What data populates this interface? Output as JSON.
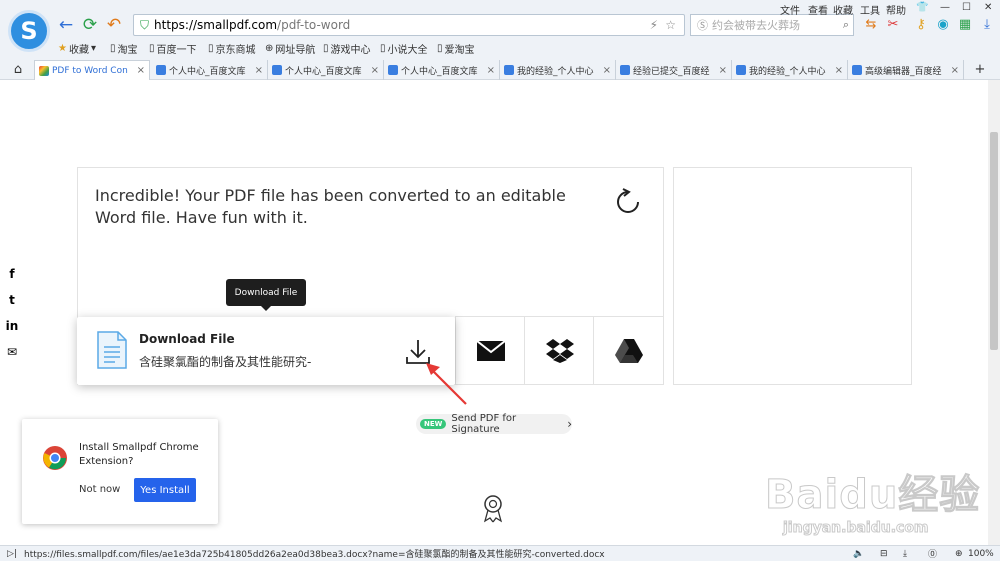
{
  "browser": {
    "url_domain": "https://smallpdf.com",
    "url_path": "/pdf-to-word",
    "search_placeholder": "约会被带去火葬场",
    "menu": [
      "文件",
      "查看",
      "收藏",
      "工具",
      "帮助"
    ],
    "bookmarks": [
      "收藏",
      "淘宝",
      "百度一下",
      "京东商城",
      "网址导航",
      "游戏中心",
      "小说大全",
      "爱淘宝"
    ],
    "tabs": [
      {
        "label": "PDF to Word Con"
      },
      {
        "label": "个人中心_百度文库"
      },
      {
        "label": "个人中心_百度文库"
      },
      {
        "label": "个人中心_百度文库"
      },
      {
        "label": "我的经验_个人中心"
      },
      {
        "label": "经验已提交_百度经"
      },
      {
        "label": "我的经验_个人中心"
      },
      {
        "label": "高级编辑器_百度经"
      }
    ],
    "status_url": "https://files.smallpdf.com/files/ae1e3da725b41805dd26a2ea0d38bea3.docx?name=含硅聚氯酯的制备及其性能研究-converted.docx",
    "zoom": "100%"
  },
  "page": {
    "message": "Incredible! Your PDF file has been converted to an editable Word file. Have fun with it.",
    "tooltip": "Download File",
    "download_title": "Download File",
    "file_name": "含硅聚氯酯的制备及其性能研究-",
    "pill_badge": "NEW",
    "pill_text": "Send PDF for Signature",
    "popup_title": "Install Smallpdf Chrome Extension?",
    "popup_not_now": "Not now",
    "popup_install": "Yes Install",
    "social": [
      "f",
      "t",
      "in",
      "✉"
    ]
  },
  "watermark": {
    "text": "Baidu经验",
    "sub": "jingyan.baidu.com"
  },
  "colors": {
    "accent": "#2563eb",
    "badge": "#36c67a",
    "arrow": "#e53935"
  }
}
